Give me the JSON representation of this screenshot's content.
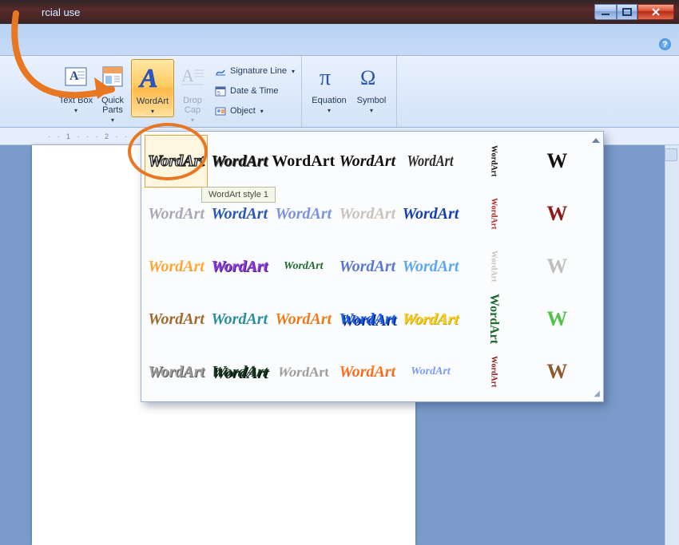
{
  "window": {
    "title_fragment": "rcial use"
  },
  "ribbon": {
    "text_box": "Text Box",
    "quick_parts": "Quick Parts",
    "wordart": "WordArt",
    "drop_cap": "Drop Cap",
    "signature_line": "Signature Line",
    "date_time": "Date & Time",
    "object": "Object",
    "equation": "Equation",
    "symbol": "Symbol",
    "caret": "▾"
  },
  "ruler": {
    "marks": "·  ·  1  ·  ·  ·  2  ·  ·  ·"
  },
  "gallery": {
    "sample": "WordArt",
    "w": "W",
    "tooltip": "WordArt style 1"
  },
  "help_glyph": "?"
}
